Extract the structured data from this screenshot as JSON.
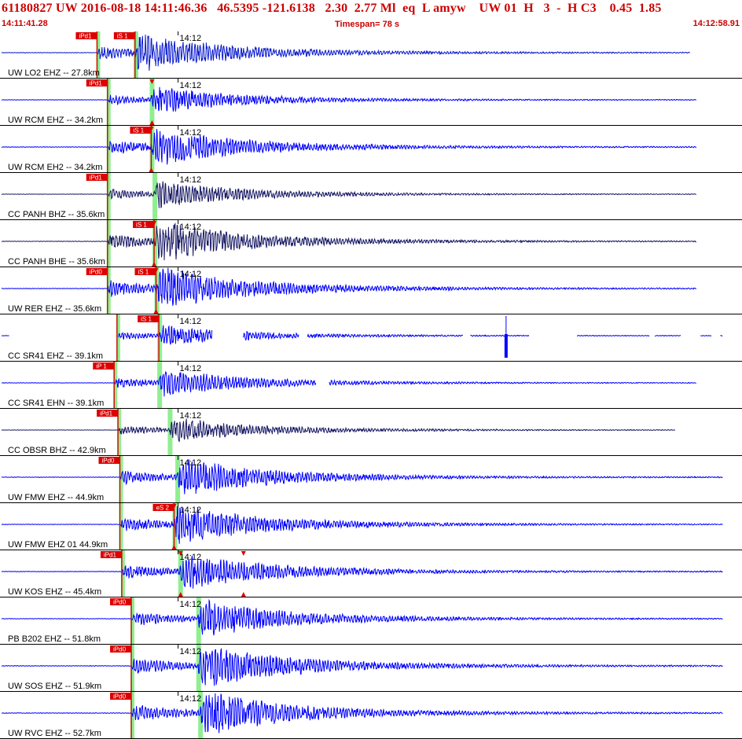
{
  "header": {
    "title": "61180827 UW 2016-08-18 14:11:46.36   46.5395 -121.6138   2.30  2.77 Ml  eq  L amyw    UW 01  H   3  -  H C3    0.45  1.85",
    "start_time": "14:11:41.28",
    "timespan": "Timespan=  78 s",
    "end_time": "14:12:58.91"
  },
  "colors": {
    "trace_blue": "#0000ff",
    "trace_navy": "#1a1a66",
    "pick_red": "#dd0000",
    "pick_window_green": "#90ee90",
    "header_red": "#cc0000"
  },
  "chart_data": {
    "type": "line",
    "description_time_axis": "seconds after 14:11:41.28",
    "xlim": [
      0,
      78
    ],
    "minute_tick": "14:12",
    "minute_tick_t": 18.72,
    "channels": [
      {
        "label": "UW LO2 EHZ -- 27.8km",
        "color": "navy_blue",
        "pick_p": "iPd1",
        "p_t": 10.2,
        "pick_s": "iS 1",
        "s_t": 14.2,
        "s_marker": false,
        "amp": 0.8,
        "end_t": 72.5,
        "gaps": []
      },
      {
        "label": "UW RCM EHZ -- 34.2km",
        "color": "blue",
        "pick_p": "iPd1",
        "p_t": 11.3,
        "pick_s": "",
        "s_t": 15.9,
        "s_marker": true,
        "amp": 0.55,
        "end_t": 73.2,
        "gaps": []
      },
      {
        "label": "UW RCM EH2 -- 34.2km",
        "color": "blue",
        "pick_p": "",
        "p_t": 11.3,
        "pick_s": "iS 1",
        "s_t": 15.9,
        "s_marker": true,
        "amp": 0.8,
        "end_t": 73.2,
        "gaps": []
      },
      {
        "label": "CC PANH BHZ -- 35.6km",
        "color": "navy",
        "pick_p": "iPd1",
        "p_t": 11.3,
        "pick_s": "",
        "s_t": 16.2,
        "s_marker": false,
        "amp": 0.55,
        "end_t": 73.2,
        "gaps": []
      },
      {
        "label": "CC PANH BHE -- 35.6km",
        "color": "navy",
        "pick_p": "",
        "p_t": 11.3,
        "pick_s": "iS 1",
        "s_t": 16.2,
        "s_marker": true,
        "amp": 0.85,
        "end_t": 73.2,
        "gaps": []
      },
      {
        "label": "UW RER EHZ -- 35.6km",
        "color": "blue",
        "pick_p": "iPd0",
        "p_t": 11.3,
        "pick_s": "iS 1",
        "s_t": 16.4,
        "s_marker": true,
        "amp": 0.9,
        "end_t": 73.2,
        "gaps": []
      },
      {
        "label": "CC SR41 EHZ -- 39.1km",
        "color": "blue",
        "pick_p": "",
        "p_t": 12.3,
        "pick_s": "iS 1",
        "s_t": 16.7,
        "s_marker": false,
        "amp": 0.4,
        "end_t": 76.0,
        "gaps": [
          [
            1.0,
            12.4
          ],
          [
            22.3,
            25.5
          ],
          [
            31.4,
            32.3
          ],
          [
            48.7,
            49.4
          ],
          [
            55.6,
            60.6
          ],
          [
            68.3,
            68.8
          ],
          [
            71.6,
            73.6
          ],
          [
            74.8,
            75.7
          ]
        ],
        "spike_t": 53.2
      },
      {
        "label": "CC SR41 EHN -- 39.1km",
        "color": "blue",
        "pick_p": "iP 1",
        "p_t": 12.0,
        "pick_s": "",
        "s_t": 16.7,
        "s_marker": false,
        "amp": 0.55,
        "end_t": 73.2,
        "gaps": [
          [
            33.2,
            34.6
          ]
        ]
      },
      {
        "label": "CC OBSR BHZ -- 42.9km",
        "color": "navy",
        "pick_p": "iPd1",
        "p_t": 12.4,
        "pick_s": "",
        "s_t": 17.8,
        "s_marker": false,
        "amp": 0.5,
        "end_t": 71.0,
        "gaps": []
      },
      {
        "label": "UW FMW EHZ -- 44.9km",
        "color": "blue",
        "pick_p": "iPd0",
        "p_t": 12.6,
        "pick_s": "",
        "s_t": 18.6,
        "s_marker": false,
        "amp": 0.8,
        "end_t": 76.0,
        "gaps": []
      },
      {
        "label": "UW FMW EHZ 01 44.9km",
        "color": "blue",
        "pick_p": "",
        "p_t": 12.6,
        "pick_s": "eS 2",
        "s_t": 18.3,
        "s_marker": true,
        "amp": 0.8,
        "end_t": 76.0,
        "gaps": []
      },
      {
        "label": "UW KOS EHZ -- 45.4km",
        "color": "blue",
        "pick_p": "iPd1",
        "p_t": 12.8,
        "pick_s": "",
        "s_t": 18.9,
        "s_marker": true,
        "s2_t": 25.6,
        "amp": 0.8,
        "end_t": 76.0,
        "gaps": []
      },
      {
        "label": "PB B202 EHZ -- 51.8km",
        "color": "blue",
        "pick_p": "iPd0",
        "p_t": 13.8,
        "pick_s": "",
        "s_t": 20.8,
        "s_marker": false,
        "amp": 0.8,
        "end_t": 76.0,
        "gaps": []
      },
      {
        "label": "UW SOS EHZ -- 51.9km",
        "color": "blue",
        "pick_p": "iPd0",
        "p_t": 13.8,
        "pick_s": "",
        "s_t": 20.8,
        "s_marker": false,
        "amp": 0.95,
        "end_t": 76.0,
        "gaps": []
      },
      {
        "label": "UW RVC EHZ -- 52.7km",
        "color": "blue",
        "pick_p": "iPd0",
        "p_t": 13.8,
        "pick_s": "",
        "s_t": 21.0,
        "s_marker": false,
        "amp": 0.95,
        "end_t": 76.0,
        "gaps": []
      }
    ]
  }
}
